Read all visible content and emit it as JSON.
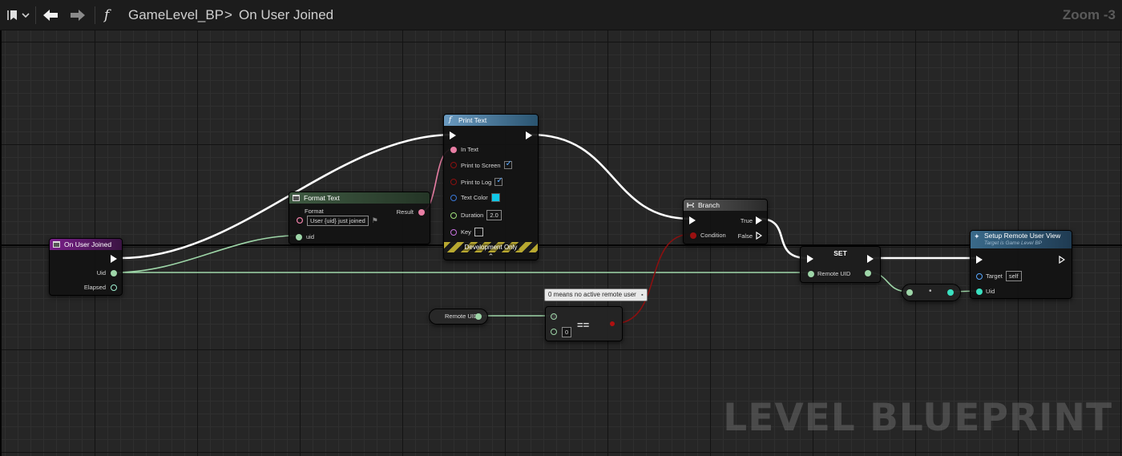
{
  "topbar": {
    "breadcrumb_blueprint": "GameLevel_BP",
    "breadcrumb_separator": ">",
    "breadcrumb_graph": "On User Joined",
    "function_symbol": "f",
    "zoom": "Zoom -3"
  },
  "watermark": "LEVEL BLUEPRINT",
  "nodes": {
    "on_user_joined": {
      "title": "On User Joined",
      "pins": [
        "Uid",
        "Elapsed"
      ]
    },
    "format_text": {
      "title": "Format Text",
      "format_label": "Format",
      "format_value": "User {uid} just joined",
      "result_label": "Result",
      "uid_label": "uid"
    },
    "print_text": {
      "title": "Print Text",
      "in_text": "In Text",
      "print_to_screen": "Print to Screen",
      "print_to_log": "Print to Log",
      "text_color": "Text Color",
      "duration_label": "Duration",
      "duration_value": "2.0",
      "key_label": "Key",
      "footer": "Development Only",
      "expand_glyph": "⌃"
    },
    "branch": {
      "title": "Branch",
      "true_label": "True",
      "condition_label": "Condition",
      "false_label": "False"
    },
    "set": {
      "title": "SET",
      "remote_uid_label": "Remote UID"
    },
    "setup_remote_user_view": {
      "title": "Setup Remote User View",
      "subtitle": "Target is Game Level BP",
      "target_label": "Target",
      "target_value": "self",
      "uid_label": "Uid"
    },
    "remote_uid_getter": {
      "label": "Remote UID"
    },
    "equals": {
      "operator": "==",
      "input_value": "0",
      "comment": "0 means no active remote user"
    },
    "convert": {
      "dot": "•"
    }
  },
  "colors": {
    "exec_wire": "#ffffff",
    "int_wire": "#9ed6a8",
    "text_wire": "#e87ea4",
    "bool_wire": "#8a1010",
    "event_header": "#7a1f8a",
    "function_header": "#3a6a8a",
    "pure_header": "#3f5a42",
    "branch_header": "#4a4a4a"
  }
}
